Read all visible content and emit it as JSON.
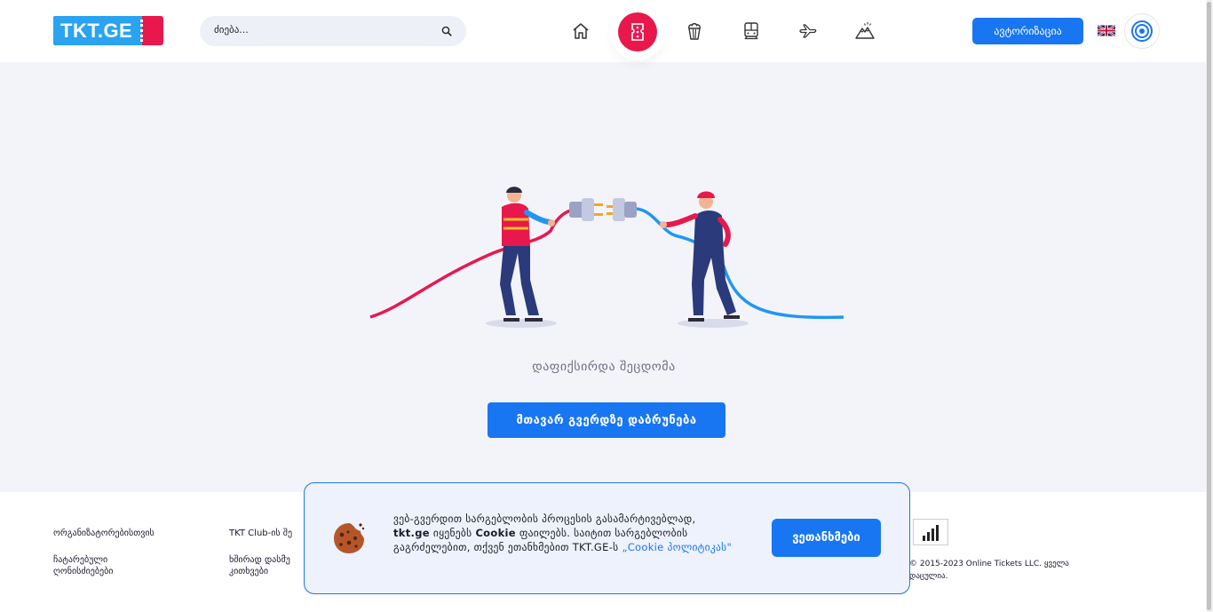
{
  "header": {
    "logo_text": "TKT.GE",
    "search_placeholder": "ძიება...",
    "auth_label": "ავტორიზაცია",
    "nav": [
      {
        "icon": "home-icon"
      },
      {
        "icon": "ticket-icon",
        "active": true
      },
      {
        "icon": "popcorn-icon"
      },
      {
        "icon": "train-icon"
      },
      {
        "icon": "airplane-icon"
      },
      {
        "icon": "mountain-icon"
      }
    ],
    "language_flag": "gb-flag-icon"
  },
  "error": {
    "message": "დაფიქსირდა შეცდომა",
    "home_button": "მთავარ გვერდზე დაბრუნება"
  },
  "footer": {
    "links": [
      "ორგანიზატორებისთვის",
      "TKT Club-ის შე",
      "ჩატარებული ღონისძიებები",
      "ხშირად დასმუ კითხვები"
    ],
    "copyright": "© 2015-2023 Online Tickets LLC. ყველა დაცულია."
  },
  "cookie": {
    "text_1": "ვებ-გვერდით სარგებლობის პროცესის გასამარტივებლად,",
    "site_name": "tkt.ge",
    "text_2": "იყენებს",
    "cookie_word": "Cookie",
    "text_3": "ფაილებს. საიტით სარგებლობის გაგრძელებით, თქვენ ეთანხმებით TKT.GE-ს",
    "policy_link": "„Cookie პოლიტიკას\"",
    "agree_button": "ვეთანხმები"
  },
  "colors": {
    "primary": "#1976f2",
    "accent": "#e8184d",
    "logo_blue": "#2aa3f0",
    "background": "#f3f4fa"
  }
}
